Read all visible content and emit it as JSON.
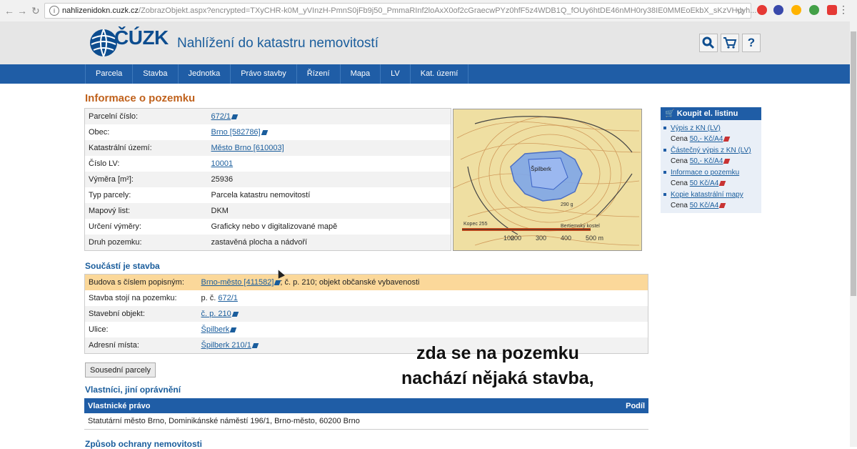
{
  "browser": {
    "url_host": "nahlizenidokn.cuzk.cz",
    "url_path": "/ZobrazObjekt.aspx?encrypted=TXyCHR-k0M_yVInzH-PmnS0jFb9j50_PmmaRInf2loAxX0of2cGraecwPYz0hfF5z4WDB1Q_fOUy6htDE46nMH0ry38IE0MMEoEkbX_sKzVHuyh..."
  },
  "header": {
    "logo_text": "ČÚZK",
    "site_title": "Nahlížení do katastru nemovitostí",
    "icons": [
      "search-icon",
      "cart-icon",
      "help-icon"
    ],
    "help_label": "?"
  },
  "nav": {
    "items": [
      "Parcela",
      "Stavba",
      "Jednotka",
      "Právo stavby",
      "Řízení",
      "Mapa",
      "LV",
      "Kat. území"
    ]
  },
  "parcel": {
    "title": "Informace o pozemku",
    "rows": [
      {
        "label": "Parcelní číslo:",
        "value": "672/1",
        "link": true
      },
      {
        "label": "Obec:",
        "value": "Brno [582786]",
        "link": true
      },
      {
        "label": "Katastrální území:",
        "value": "Město Brno [610003]",
        "link": true
      },
      {
        "label": "Číslo LV:",
        "value": "10001",
        "link": true
      },
      {
        "label": "Výměra [m²]:",
        "value": "25936",
        "link": false
      },
      {
        "label": "Typ parcely:",
        "value": "Parcela katastru nemovitostí",
        "link": false
      },
      {
        "label": "Mapový list:",
        "value": "DKM",
        "link": false
      },
      {
        "label": "Určení výměry:",
        "value": "Graficky nebo v digitalizované mapě",
        "link": false
      },
      {
        "label": "Druh pozemku:",
        "value": "zastavěná plocha a nádvoří",
        "link": false
      }
    ]
  },
  "map": {
    "scale_labels": [
      "100",
      "200",
      "300",
      "400",
      "500 m"
    ],
    "map_labels": [
      "Špilberk",
      "Bertiemský kostel",
      "Kopec 255",
      "290 g"
    ]
  },
  "building": {
    "title": "Součástí je stavba",
    "rows": [
      {
        "label": "Budova s číslem popisným:",
        "link": "Brno-město [411582]",
        "suffix": "; č. p. 210; objekt občanské vybavenosti",
        "highlight": true
      },
      {
        "label": "Stavba stojí na pozemku:",
        "prefix": "p. č. ",
        "link": "672/1",
        "suffix": ""
      },
      {
        "label": "Stavební objekt:",
        "link": "č. p. 210",
        "suffix": ""
      },
      {
        "label": "Ulice:",
        "link": "Špilberk",
        "suffix": ""
      },
      {
        "label": "Adresní místa:",
        "link": "Špilberk 210/1",
        "suffix": ""
      }
    ]
  },
  "neighbor_button": "Sousední parcely",
  "owners": {
    "title": "Vlastníci, jiní oprávnění",
    "col_right": "Vlastnické právo",
    "col_share": "Podíl",
    "rows": [
      "Statutární město Brno, Dominikánské náměstí 196/1, Brno-město, 60200 Brno"
    ]
  },
  "protection_title": "Způsob ochrany nemovitosti",
  "sidebar": {
    "title": "Koupit el. listinu",
    "items": [
      {
        "label": "Výpis z KN (LV)",
        "price_label": "Cena ",
        "price": "50,- Kč/A4"
      },
      {
        "label": "Částečný výpis z KN (LV)",
        "price_label": "Cena ",
        "price": "50,- Kč/A4"
      },
      {
        "label": "Informace o pozemku",
        "price_label": "Cena ",
        "price": "50 Kč/A4"
      },
      {
        "label": "Kopie katastrální mapy",
        "price_label": "Cena ",
        "price": "50 Kč/A4"
      }
    ]
  },
  "caption": {
    "line1": "zda se na pozemku",
    "line2": "nachází nějaká stavba,"
  }
}
